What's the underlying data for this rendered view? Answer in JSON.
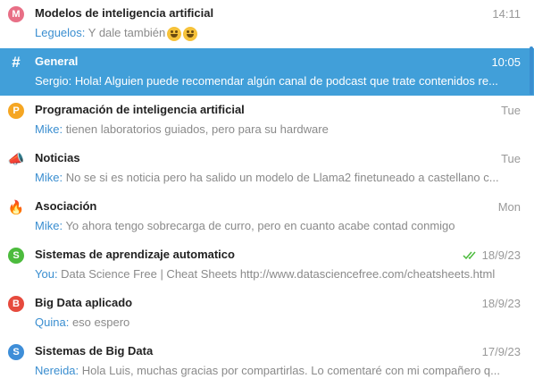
{
  "chats": [
    {
      "icon_type": "letter",
      "icon_text": "M",
      "icon_color": "#e86f86",
      "icon_name": "avatar-m-icon",
      "title": "Modelos de inteligencia artificial",
      "time": "14:11",
      "sender": "Leguelos",
      "sep": ": ",
      "text": "Y dale también",
      "emoji": "grinning-face-icon",
      "selected": false,
      "read": false
    },
    {
      "icon_type": "glyph",
      "icon_text": "#",
      "icon_color": "#ffffff",
      "icon_name": "hashtag-icon",
      "title": "General",
      "time": "10:05",
      "sender": "Sergio",
      "sep": ": ",
      "text": "Hola! Alguien puede recomendar algún canal de podcast que trate contenidos re...",
      "selected": true,
      "read": false
    },
    {
      "icon_type": "letter",
      "icon_text": "P",
      "icon_color": "#f5a623",
      "icon_name": "avatar-p-icon",
      "title": "Programación de inteligencia artificial",
      "time": "Tue",
      "sender": "Mike",
      "sep": ": ",
      "text": "tienen laboratorios guiados, pero para su hardware",
      "selected": false,
      "read": false
    },
    {
      "icon_type": "emoji",
      "icon_text": "📣",
      "icon_color": "#8a6d3b",
      "icon_name": "megaphone-icon",
      "title": "Noticias",
      "time": "Tue",
      "sender": "Mike",
      "sep": ": ",
      "text": "No se si es noticia pero ha salido un modelo de Llama2 finetuneado a castellano c...",
      "selected": false,
      "read": false
    },
    {
      "icon_type": "emoji",
      "icon_text": "🔥",
      "icon_color": "#f05a28",
      "icon_name": "fire-icon",
      "title": "Asociación",
      "time": "Mon",
      "sender": "Mike",
      "sep": ": ",
      "text": "Yo ahora tengo sobrecarga de curro, pero en cuanto acabe contad conmigo",
      "selected": false,
      "read": false
    },
    {
      "icon_type": "letter",
      "icon_text": "S",
      "icon_color": "#4cbb3d",
      "icon_name": "avatar-s-icon",
      "title": "Sistemas de aprendizaje automatico",
      "time": "18/9/23",
      "sender": "You",
      "sep": ": ",
      "text": "Data Science Free | Cheat Sheets http://www.datasciencefree.com/cheatsheets.html",
      "selected": false,
      "read": true
    },
    {
      "icon_type": "letter",
      "icon_text": "B",
      "icon_color": "#e64a3d",
      "icon_name": "avatar-b-icon",
      "title": "Big Data aplicado",
      "time": "18/9/23",
      "sender": "Quina",
      "sep": ": ",
      "text": "eso espero",
      "selected": false,
      "read": false
    },
    {
      "icon_type": "letter",
      "icon_text": "S",
      "icon_color": "#3e8ed8",
      "icon_name": "avatar-s-icon",
      "title": "Sistemas de Big Data",
      "time": "17/9/23",
      "sender": "Nereida",
      "sep": ": ",
      "text": "Hola Luis, muchas gracias por compartirlas. Lo comentaré con mi compañero q...",
      "selected": false,
      "read": false
    }
  ],
  "colors": {
    "accent": "#419fd9",
    "sender": "#3a8ed0",
    "check": "#4cbb3d"
  }
}
